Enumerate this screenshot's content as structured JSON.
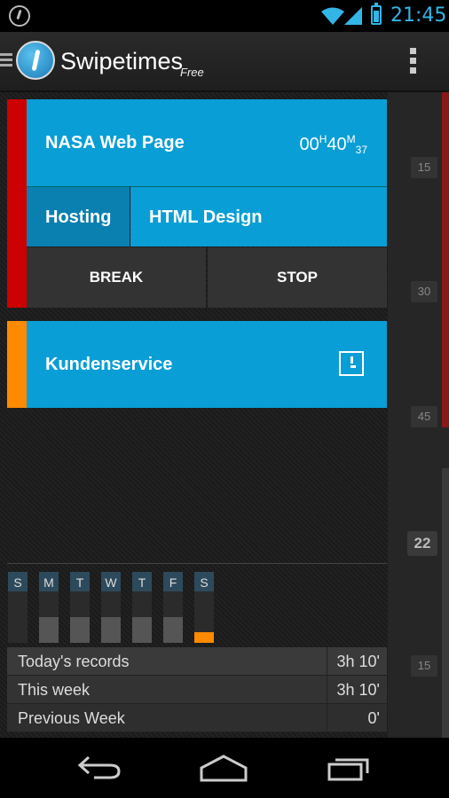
{
  "status_bar": {
    "time": "21:45",
    "icons": [
      "sync-icon",
      "wifi-icon",
      "signal-icon",
      "battery-icon"
    ]
  },
  "action_bar": {
    "title": "Swipetimes",
    "subtitle": "Free",
    "icons": [
      "drawer-icon",
      "app-logo-icon",
      "overflow-menu-icon"
    ]
  },
  "active_task": {
    "title": "NASA Web Page",
    "timer": {
      "hours": "00",
      "h_unit": "H",
      "minutes": "40",
      "m_unit": "M",
      "seconds": "37"
    },
    "tags": [
      "Hosting",
      "HTML Design"
    ],
    "break_label": "BREAK",
    "stop_label": "STOP",
    "color": "#cc0000"
  },
  "tasks": [
    {
      "title": "Kundenservice",
      "color": "#ff8a00",
      "icon": "start-task-icon"
    }
  ],
  "timeline": {
    "ticks": [
      "15",
      "30",
      "45",
      "15"
    ],
    "hour": "22"
  },
  "week": {
    "days": [
      {
        "label": "S",
        "fill": 0
      },
      {
        "label": "M",
        "fill": 0.5
      },
      {
        "label": "T",
        "fill": 0.5
      },
      {
        "label": "W",
        "fill": 0.5
      },
      {
        "label": "T",
        "fill": 0.5
      },
      {
        "label": "F",
        "fill": 0.5
      },
      {
        "label": "S",
        "fill": 0.2,
        "current": true
      }
    ]
  },
  "records": [
    {
      "label": "Today's records",
      "value": "3h 10'"
    },
    {
      "label": "This week",
      "value": "3h 10'"
    },
    {
      "label": "Previous Week",
      "value": "0'"
    }
  ],
  "nav_bar": {
    "icons": [
      "back-icon",
      "home-icon",
      "recent-apps-icon"
    ]
  }
}
